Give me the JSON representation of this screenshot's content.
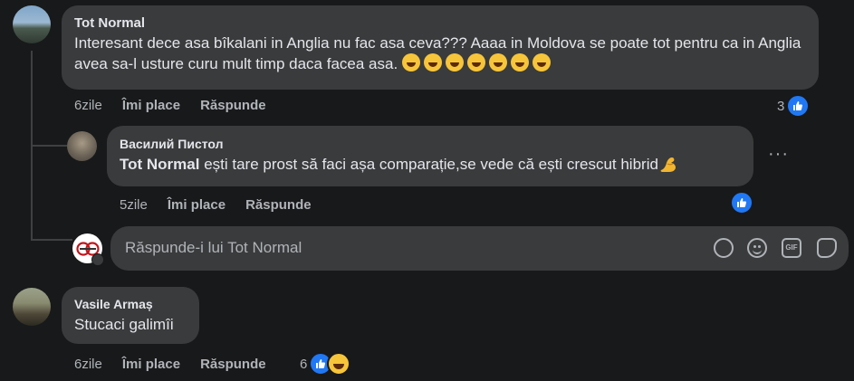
{
  "comments": [
    {
      "author": "Tot Normal",
      "text": "Interesant dece asa bîkalani in Anglia nu fac asa ceva??? Aaaa in Moldova se poate tot pentru ca in Anglia avea sa-l usture curu mult timp daca facea asa.",
      "time": "6zile",
      "like_label": "Îmi place",
      "reply_label": "Răspunde",
      "reaction_count": "3",
      "emoji": "rolling-on-floor-laughing x7"
    },
    {
      "author": "Василий Пистол",
      "mention": "Tot Normal",
      "text": " ești tare prost să faci așa comparație,se vede că ești crescut hibrid",
      "time": "5zile",
      "like_label": "Îmi place",
      "reply_label": "Răspunde",
      "emoji": "flexed-biceps",
      "more_label": "···"
    },
    {
      "author": "Vasile Armaș",
      "text": "Stucaci galimîi",
      "time": "6zile",
      "like_label": "Îmi place",
      "reply_label": "Răspunde",
      "reaction_count": "6",
      "emoji": "like + laughing"
    }
  ],
  "reply_box": {
    "placeholder": "Răspunde-i lui Tot Normal"
  },
  "colors": {
    "background": "#18191a",
    "bubble": "#3a3b3c",
    "secondary_text": "#b0b3b8",
    "like_blue": "#2078f4"
  }
}
